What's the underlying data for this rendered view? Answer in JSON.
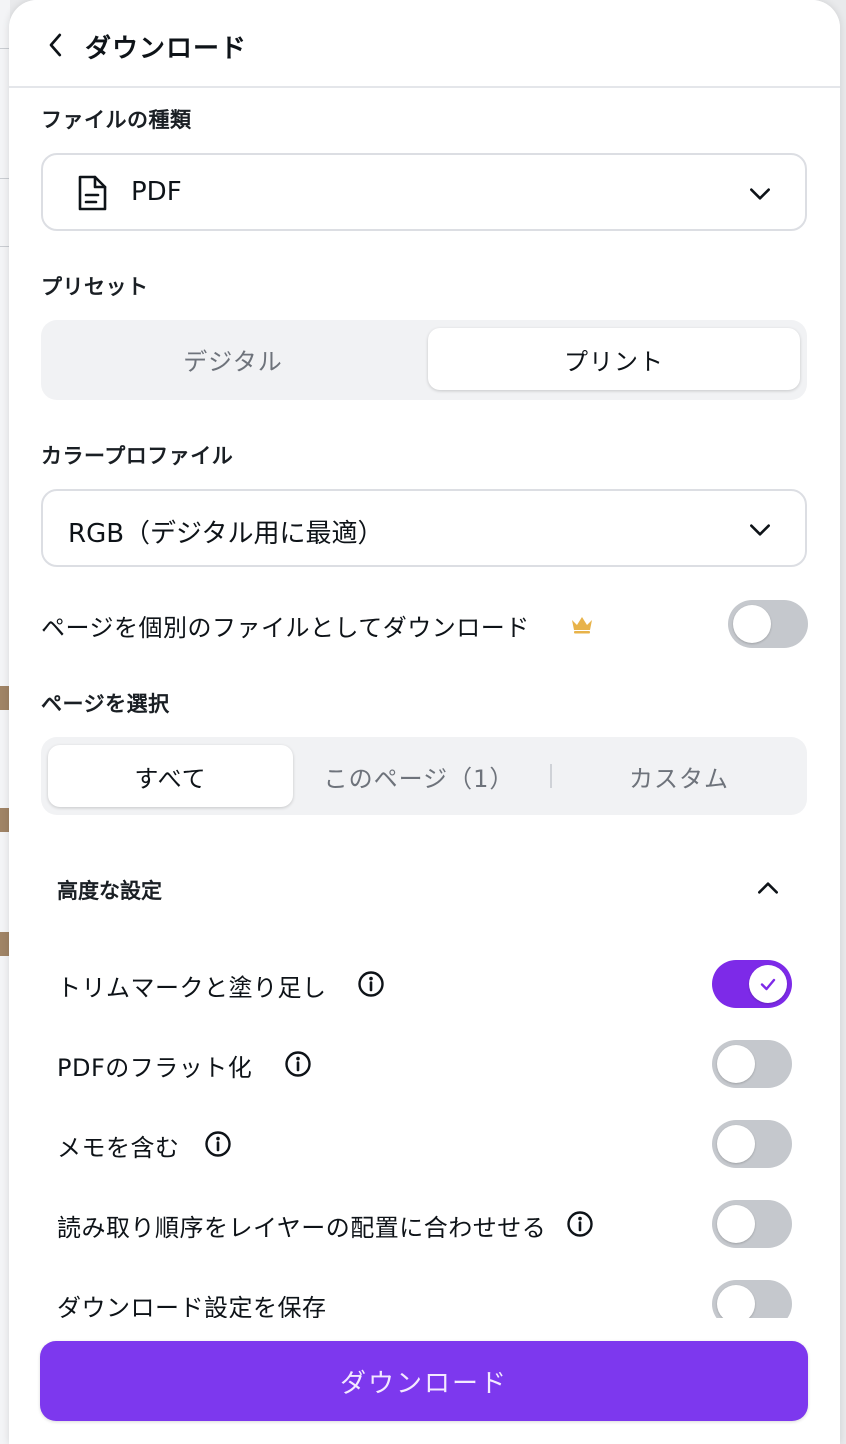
{
  "header": {
    "title": "ダウンロード",
    "back_icon": "chevron-left-icon"
  },
  "file_type": {
    "label": "ファイルの種類",
    "value": "PDF",
    "icon": "document-icon"
  },
  "preset": {
    "label": "プリセット",
    "options": [
      "デジタル",
      "プリント"
    ],
    "selected": "プリント"
  },
  "color_profile": {
    "label": "カラープロファイル",
    "value": "RGB（デジタル用に最適）"
  },
  "separate_files": {
    "label": "ページを個別のファイルとしてダウンロード",
    "icon": "crown-icon",
    "enabled": false
  },
  "page_select": {
    "label": "ページを選択",
    "options": [
      "すべて",
      "このページ（1）",
      "カスタム"
    ],
    "selected": "すべて"
  },
  "advanced": {
    "title": "高度な設定",
    "expanded": true,
    "options": [
      {
        "label": "トリムマークと塗り足し",
        "info": true,
        "enabled": true
      },
      {
        "label": "PDFのフラット化",
        "info": true,
        "enabled": false
      },
      {
        "label": "メモを含む",
        "info": true,
        "enabled": false
      },
      {
        "label": "読み取り順序をレイヤーの配置に合わせせる",
        "info": true,
        "enabled": false
      },
      {
        "label": "ダウンロード設定を保存",
        "info": false,
        "enabled": false
      }
    ]
  },
  "download_button": {
    "label": "ダウンロード"
  },
  "colors": {
    "accent": "#7d2ae8",
    "toggle_off": "#c5c8cd",
    "crown": "#e8b34a"
  }
}
